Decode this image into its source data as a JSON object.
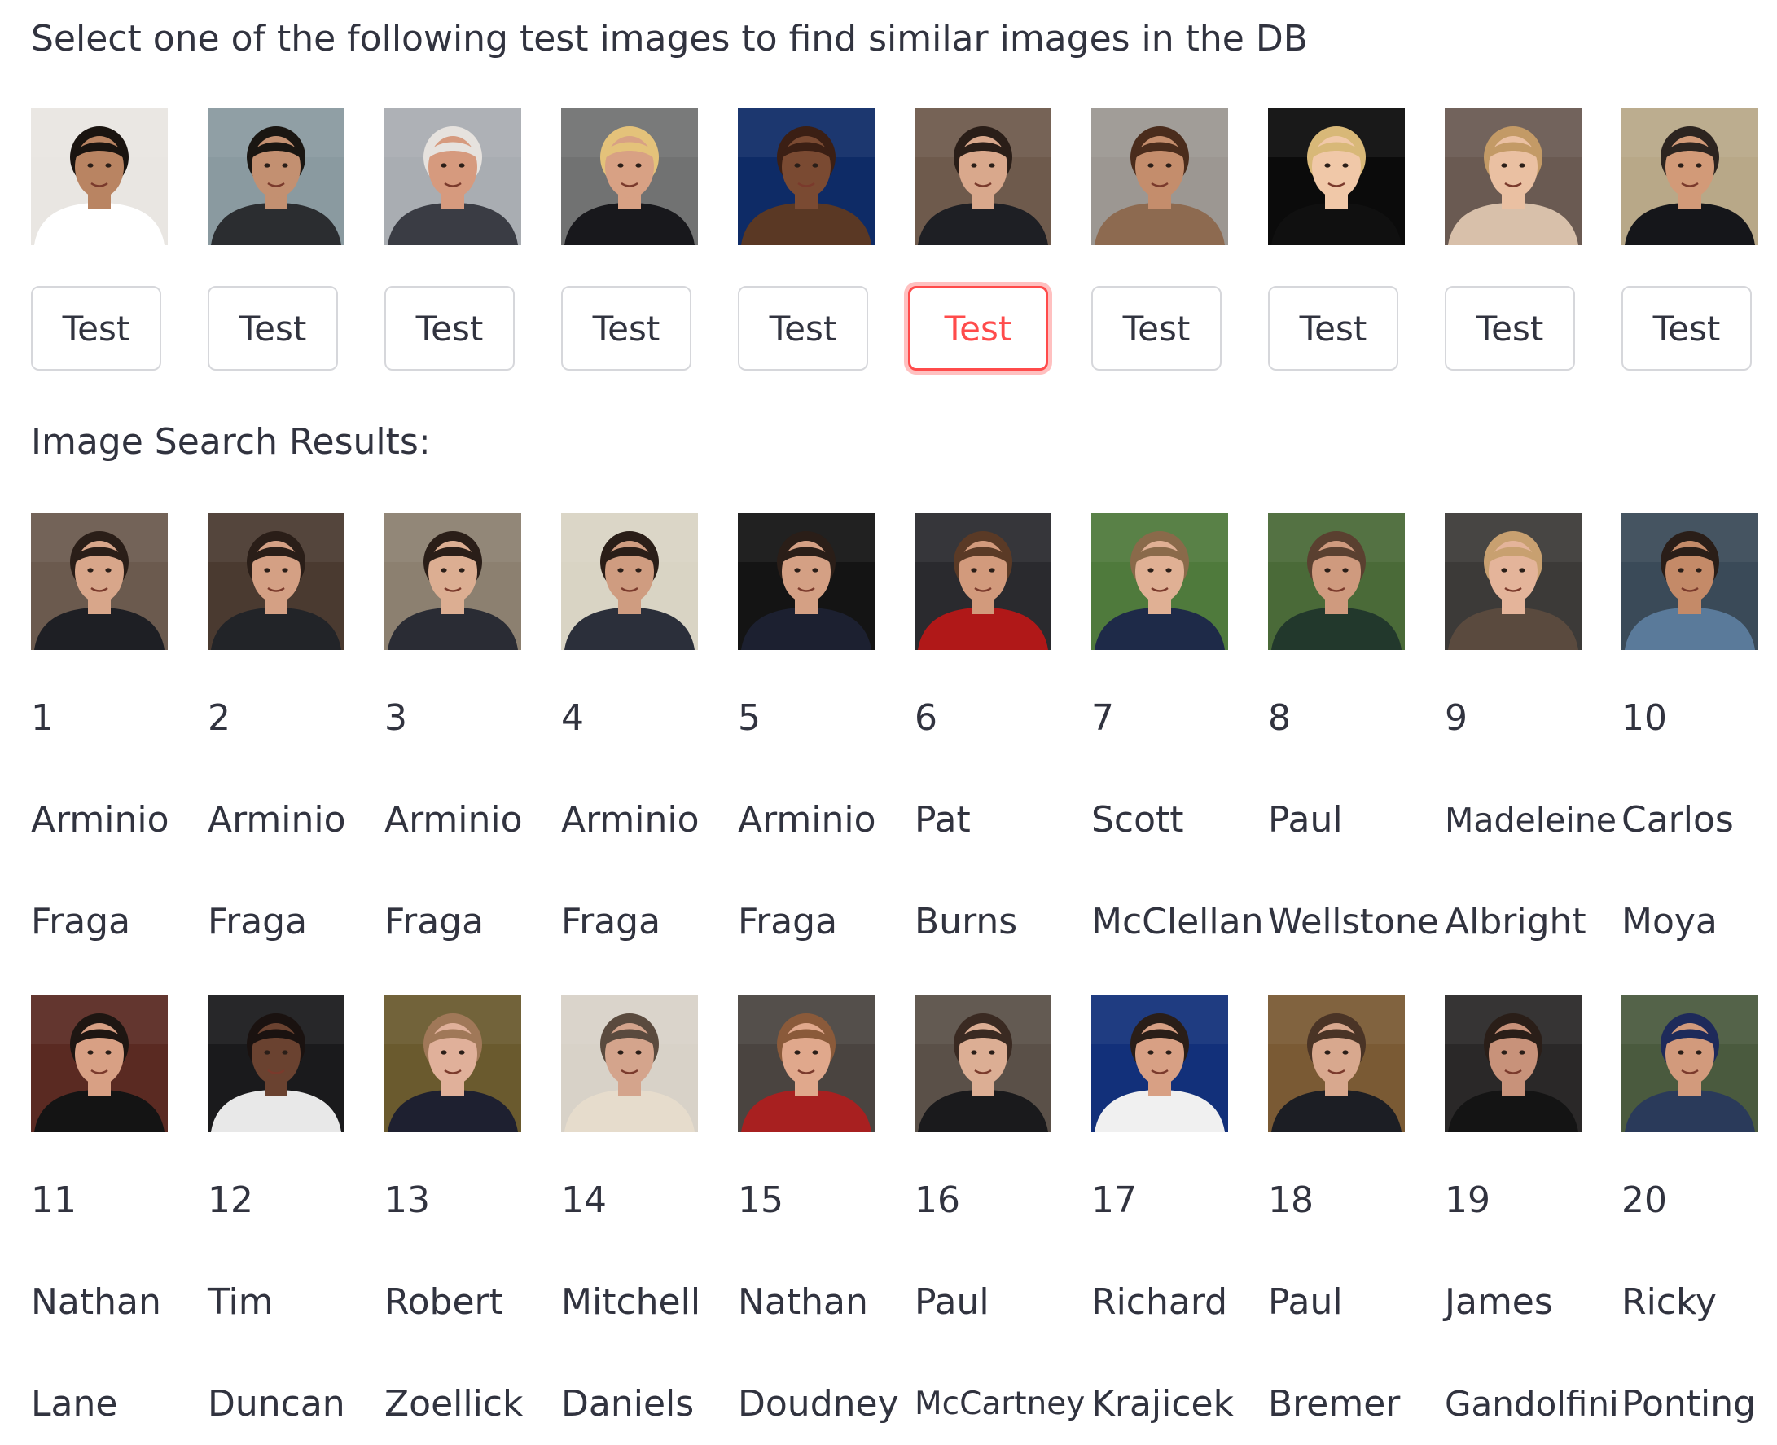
{
  "prompt": "Select one of the following test images to find similar images in the DB",
  "test_images": [
    {
      "button_label": "Test",
      "selected": false,
      "bg": "#e9e6e2",
      "skin": "#b98462",
      "hair": "#1a1410",
      "shirt": "#ffffff"
    },
    {
      "button_label": "Test",
      "selected": false,
      "bg": "#8a9aa0",
      "skin": "#c39071",
      "hair": "#1a1612",
      "shirt": "#2b2d30"
    },
    {
      "button_label": "Test",
      "selected": false,
      "bg": "#a9adb2",
      "skin": "#d69a7e",
      "hair": "#e6e2de",
      "shirt": "#3a3c44"
    },
    {
      "button_label": "Test",
      "selected": false,
      "bg": "#717272",
      "skin": "#d8a184",
      "hair": "#e4c27a",
      "shirt": "#18181c"
    },
    {
      "button_label": "Test",
      "selected": false,
      "bg": "#0e2b66",
      "skin": "#7a4a32",
      "hair": "#3b1f14",
      "shirt": "#5a3824"
    },
    {
      "button_label": "Test",
      "selected": true,
      "bg": "#6e5a4c",
      "skin": "#d9a88c",
      "hair": "#2a1e18",
      "shirt": "#1e1f24"
    },
    {
      "button_label": "Test",
      "selected": false,
      "bg": "#9c9792",
      "skin": "#c48d6c",
      "hair": "#4a2c1c",
      "shirt": "#8d6a50"
    },
    {
      "button_label": "Test",
      "selected": false,
      "bg": "#0b0b0b",
      "skin": "#f0c8a8",
      "hair": "#d8b878",
      "shirt": "#101010"
    },
    {
      "button_label": "Test",
      "selected": false,
      "bg": "#6a5a52",
      "skin": "#eac0a2",
      "hair": "#c39a66",
      "shirt": "#d8c0aa"
    },
    {
      "button_label": "Test",
      "selected": false,
      "bg": "#b8a888",
      "skin": "#d29a78",
      "hair": "#2c2420",
      "shirt": "#15161a"
    }
  ],
  "results_title": "Image Search Results:",
  "results": [
    {
      "rank": "1",
      "first": "Arminio",
      "last": "Fraga",
      "bg": "#6b5a4e",
      "skin": "#d8a68a",
      "hair": "#2a1e18",
      "shirt": "#1e1f24"
    },
    {
      "rank": "2",
      "first": "Arminio",
      "last": "Fraga",
      "bg": "#4a3a30",
      "skin": "#d4a084",
      "hair": "#2a1e18",
      "shirt": "#222428"
    },
    {
      "rank": "3",
      "first": "Arminio",
      "last": "Fraga",
      "bg": "#8c8070",
      "skin": "#dcae92",
      "hair": "#2a1e18",
      "shirt": "#2a2c34"
    },
    {
      "rank": "4",
      "first": "Arminio",
      "last": "Fraga",
      "bg": "#d9d4c4",
      "skin": "#cf9c80",
      "hair": "#2a1e18",
      "shirt": "#2b2f3a"
    },
    {
      "rank": "5",
      "first": "Arminio",
      "last": "Fraga",
      "bg": "#141414",
      "skin": "#d4a084",
      "hair": "#2a1e18",
      "shirt": "#1c2030"
    },
    {
      "rank": "6",
      "first": "Pat",
      "last": "Burns",
      "bg": "#2a2a2e",
      "skin": "#d29a7c",
      "hair": "#5a3a26",
      "shirt": "#b01818"
    },
    {
      "rank": "7",
      "first": "Scott",
      "last": "McClellan",
      "bg": "#4f7a3c",
      "skin": "#e0b094",
      "hair": "#8a6a4a",
      "shirt": "#1e2a48"
    },
    {
      "rank": "8",
      "first": "Paul",
      "last": "Wellstone",
      "bg": "#4a6a38",
      "skin": "#cf9a7e",
      "hair": "#5a4030",
      "shirt": "#22382c"
    },
    {
      "rank": "9",
      "first": "Madeleine",
      "last": "Albright",
      "bg": "#3c3a38",
      "skin": "#e4b49a",
      "hair": "#c8a070",
      "shirt": "#5a4a3e"
    },
    {
      "rank": "10",
      "first": "Carlos",
      "last": "Moya",
      "bg": "#3a4a58",
      "skin": "#c48a68",
      "hair": "#2a1e18",
      "shirt": "#5a7a9a"
    },
    {
      "rank": "11",
      "first": "Nathan",
      "last": "Lane",
      "bg": "#5a2a22",
      "skin": "#d8a084",
      "hair": "#1e1612",
      "shirt": "#141414"
    },
    {
      "rank": "12",
      "first": "Tim",
      "last": "Duncan",
      "bg": "#1a1a1c",
      "skin": "#6a4230",
      "hair": "#1a1210",
      "shirt": "#e8e8e8"
    },
    {
      "rank": "13",
      "first": "Robert",
      "last": "Zoellick",
      "bg": "#6a5a2e",
      "skin": "#e0b09a",
      "hair": "#a07858",
      "shirt": "#1e2030"
    },
    {
      "rank": "14",
      "first": "Mitchell",
      "last": "Daniels",
      "bg": "#d8d2c8",
      "skin": "#d4a48c",
      "hair": "#5a4a3e",
      "shirt": "#e6dccc"
    },
    {
      "rank": "15",
      "first": "Nathan",
      "last": "Doudney",
      "bg": "#4a4440",
      "skin": "#e0a88c",
      "hair": "#8a5a3a",
      "shirt": "#a82020"
    },
    {
      "rank": "16",
      "first": "Paul",
      "last": "McCartney",
      "bg": "#5a5048",
      "skin": "#dcae94",
      "hair": "#3a2a22",
      "shirt": "#1a1a1c"
    },
    {
      "rank": "17",
      "first": "Richard",
      "last": "Krajicek",
      "bg": "#12307a",
      "skin": "#d8a084",
      "hair": "#2a1e18",
      "shirt": "#f0f0f0"
    },
    {
      "rank": "18",
      "first": "Paul",
      "last": "Bremer",
      "bg": "#7a5a34",
      "skin": "#d8a88e",
      "hair": "#4a3426",
      "shirt": "#1c1e24"
    },
    {
      "rank": "19",
      "first": "James",
      "last": "Gandolfini",
      "bg": "#2a2828",
      "skin": "#c8927a",
      "hair": "#2a1e18",
      "shirt": "#141414"
    },
    {
      "rank": "20",
      "first": "Ricky",
      "last": "Ponting",
      "bg": "#4a5a3e",
      "skin": "#d29a7c",
      "hair": "#1e2a5a",
      "shirt": "#2a3a5a"
    }
  ]
}
